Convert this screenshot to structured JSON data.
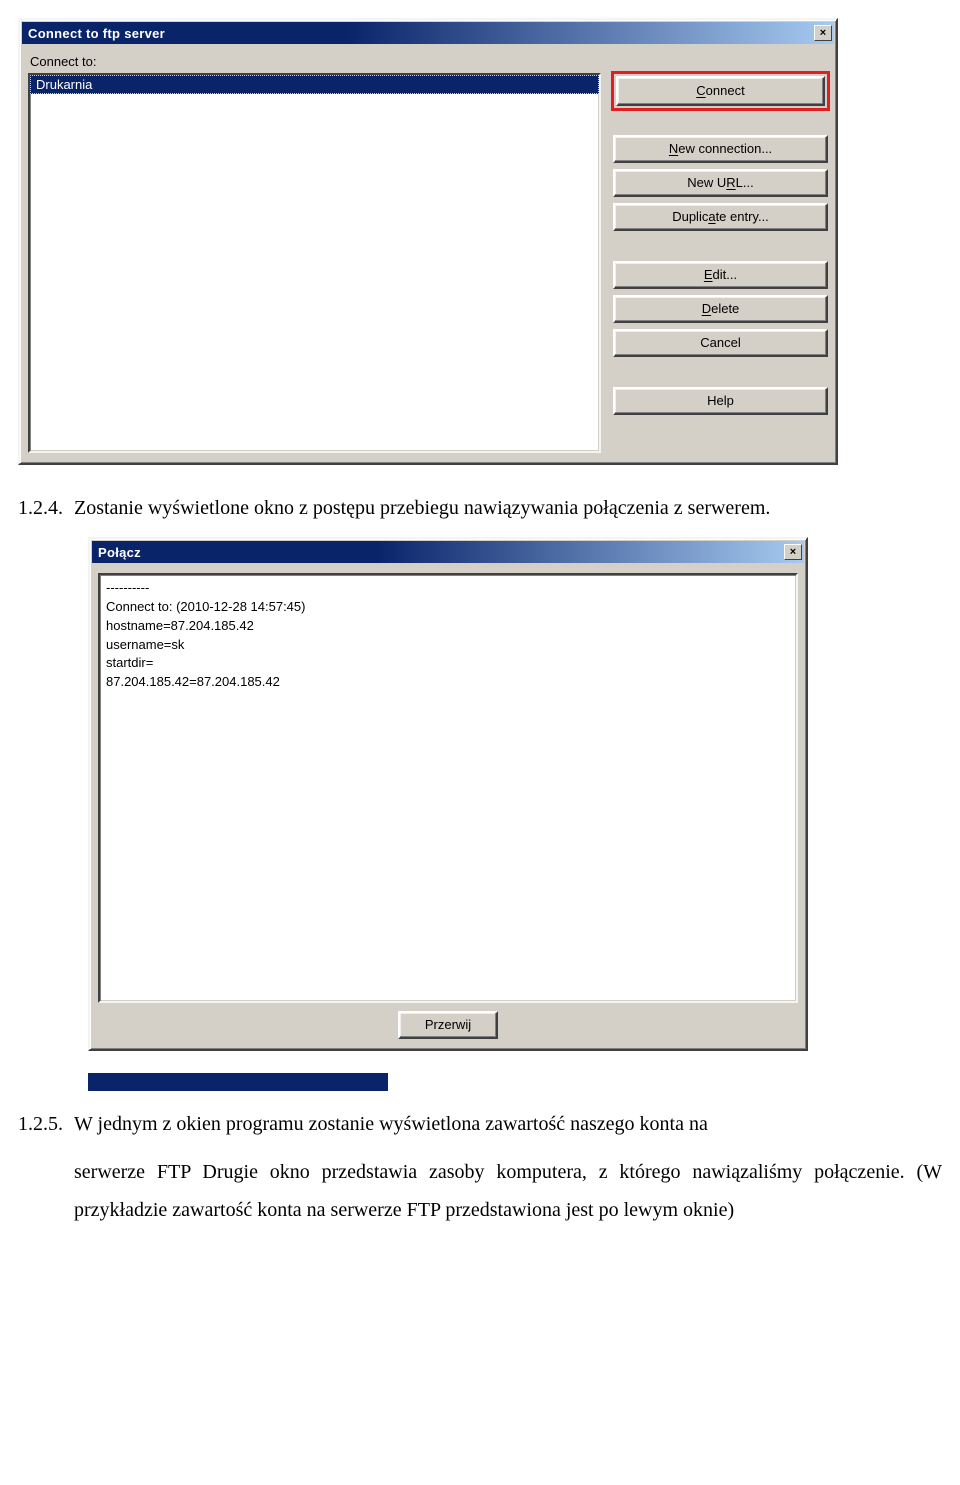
{
  "dialog1": {
    "title": "Connect to ftp server",
    "close": "×",
    "label": "Connect to:",
    "list_item": "Drukarnia",
    "buttons": {
      "connect": {
        "pre": "",
        "u": "C",
        "post": "onnect"
      },
      "newconn": {
        "pre": "",
        "u": "N",
        "post": "ew connection..."
      },
      "newurl": {
        "pre": "New U",
        "u": "R",
        "post": "L..."
      },
      "dup": {
        "pre": "Duplic",
        "u": "a",
        "post": "te entry..."
      },
      "edit": {
        "pre": "",
        "u": "E",
        "post": "dit..."
      },
      "delete": {
        "pre": "",
        "u": "D",
        "post": "elete"
      },
      "cancel": "Cancel",
      "help": "Help"
    }
  },
  "para1": {
    "num": "1.2.4.",
    "text": "Zostanie wyświetlone okno z postępu przebiegu nawiązywania połączenia z serwerem."
  },
  "dialog2": {
    "title": "Połącz",
    "close": "×",
    "log": "----------\nConnect to: (2010-12-28 14:57:45)\nhostname=87.204.185.42\nusername=sk\nstartdir=\n87.204.185.42=87.204.185.42",
    "cancel": "Przerwij"
  },
  "para2": {
    "num": "1.2.5.",
    "line1": "W jednym z okien programu zostanie wyświetlona zawartość naszego konta na",
    "line2": "serwerze FTP Drugie okno przedstawia zasoby komputera, z którego nawiązaliśmy połączenie. (W przykładzie zawartość konta na serwerze FTP przedstawiona jest po lewym oknie)"
  }
}
